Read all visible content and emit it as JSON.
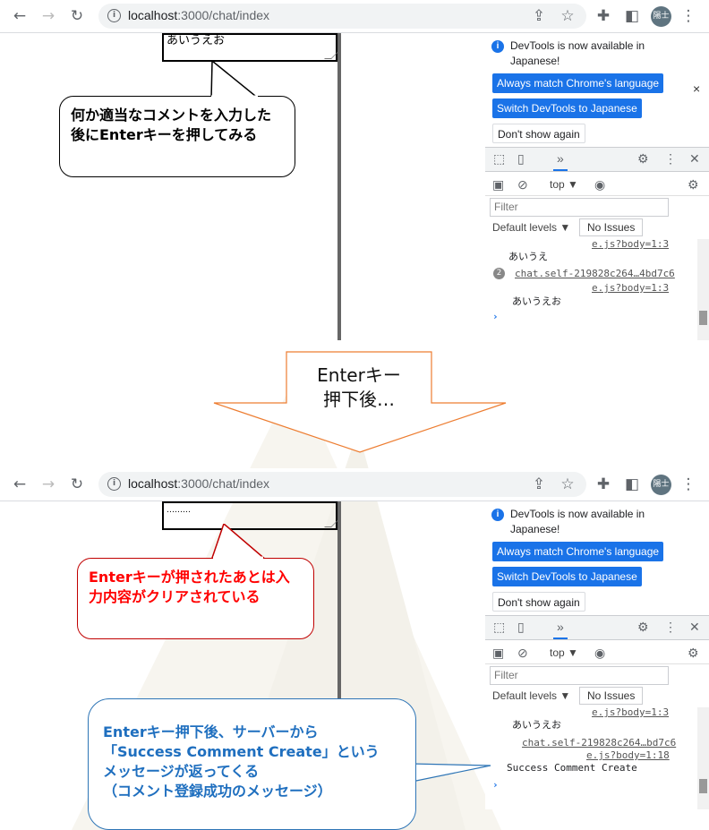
{
  "browser": {
    "url_host": "localhost",
    "url_path": ":3000/chat/index",
    "avatar_text": "陽士",
    "icons": [
      "back-icon",
      "forward-icon",
      "reload-icon",
      "info-icon",
      "share-icon",
      "star-icon",
      "extensions-icon",
      "sidepanel-icon",
      "menu-icon"
    ]
  },
  "devtools": {
    "notice_text": "DevTools is now available in Japanese!",
    "btn_match": "Always match Chrome's language",
    "btn_switch": "Switch DevTools to Japanese",
    "btn_dont_show": "Don't show again",
    "top_context": "top ▼",
    "filter_placeholder": "Filter",
    "levels": "Default levels ▼",
    "issues": "No Issues",
    "accent": "#1a73e8"
  },
  "before": {
    "textarea_value": "あいうえお",
    "log": {
      "src_tail_1": "e.js?body=1:3",
      "msg_1": "あいうえ",
      "count": "2",
      "src_2": "chat.self-219828c264…4bd7c6",
      "src_tail_2": "e.js?body=1:3",
      "msg_2": "あいうえお"
    },
    "callout": "何か適当なコメントを入力した後にEnterキーを押してみる"
  },
  "transition": {
    "line1": "Enterキー",
    "line2": "押下後…",
    "arrow_border": "#ed7d31"
  },
  "after": {
    "textarea_value": "………",
    "log": {
      "src_tail_1": "e.js?body=1:3",
      "msg_1": "あいうえお",
      "src_2": "chat.self-219828c264…bd7c6",
      "src_tail_2": "e.js?body=1:18",
      "msg_2": "Success Comment Create"
    },
    "callout_red": "Enterキーが押されたあとは入力内容がクリアされている",
    "callout_blue_1": "Enterキー押下後、サーバーから",
    "callout_blue_2": "「Success Comment Create」という",
    "callout_blue_3": "メッセージが返ってくる",
    "callout_blue_4": "（コメント登録成功のメッセージ）"
  }
}
